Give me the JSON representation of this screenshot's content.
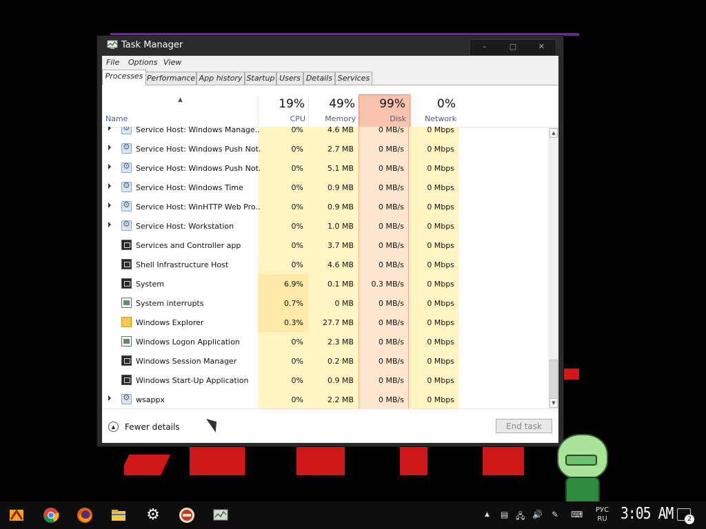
{
  "window": {
    "title": "Task Manager",
    "controls": [
      "–",
      "□",
      "✕"
    ]
  },
  "menu": [
    "File",
    "Options",
    "View"
  ],
  "tabs": [
    "Processes",
    "Performance",
    "App history",
    "Startup",
    "Users",
    "Details",
    "Services"
  ],
  "active_tab": "Processes",
  "columns": {
    "name": "Name",
    "cpu": {
      "pct": "19%",
      "label": "CPU"
    },
    "memory": {
      "pct": "49%",
      "label": "Memory"
    },
    "disk": {
      "pct": "99%",
      "label": "Disk"
    },
    "network": {
      "pct": "0%",
      "label": "Network"
    }
  },
  "rows": [
    {
      "name": "Service Host: Windows Manage...",
      "icon": "gear-icon",
      "expandable": true,
      "cpu": "0%",
      "mem": "4.6 MB",
      "disk": "0 MB/s",
      "net": "0 Mbps",
      "partial": true
    },
    {
      "name": "Service Host: Windows Push Not...",
      "icon": "gear-icon",
      "expandable": true,
      "cpu": "0%",
      "mem": "2.7 MB",
      "disk": "0 MB/s",
      "net": "0 Mbps"
    },
    {
      "name": "Service Host: Windows Push Not...",
      "icon": "gear-icon",
      "expandable": true,
      "cpu": "0%",
      "mem": "5.1 MB",
      "disk": "0 MB/s",
      "net": "0 Mbps"
    },
    {
      "name": "Service Host: Windows Time",
      "icon": "gear-icon",
      "expandable": true,
      "cpu": "0%",
      "mem": "0.9 MB",
      "disk": "0 MB/s",
      "net": "0 Mbps"
    },
    {
      "name": "Service Host: WinHTTP Web Pro...",
      "icon": "gear-icon",
      "expandable": true,
      "cpu": "0%",
      "mem": "0.9 MB",
      "disk": "0 MB/s",
      "net": "0 Mbps"
    },
    {
      "name": "Service Host: Workstation",
      "icon": "gear-icon",
      "expandable": true,
      "cpu": "0%",
      "mem": "1.0 MB",
      "disk": "0 MB/s",
      "net": "0 Mbps"
    },
    {
      "name": "Services and Controller app",
      "icon": "app-icon",
      "expandable": false,
      "cpu": "0%",
      "mem": "3.7 MB",
      "disk": "0 MB/s",
      "net": "0 Mbps"
    },
    {
      "name": "Shell Infrastructure Host",
      "icon": "app-icon",
      "expandable": false,
      "cpu": "0%",
      "mem": "4.6 MB",
      "disk": "0 MB/s",
      "net": "0 Mbps"
    },
    {
      "name": "System",
      "icon": "app-icon",
      "expandable": false,
      "cpu": "6.9%",
      "mem": "0.1 MB",
      "disk": "0.3 MB/s",
      "net": "0 Mbps"
    },
    {
      "name": "System interrupts",
      "icon": "window-icon",
      "expandable": false,
      "cpu": "0.7%",
      "mem": "0 MB",
      "disk": "0 MB/s",
      "net": "0 Mbps"
    },
    {
      "name": "Windows Explorer",
      "icon": "folder-icon",
      "expandable": false,
      "cpu": "0.3%",
      "mem": "27.7 MB",
      "disk": "0 MB/s",
      "net": "0 Mbps"
    },
    {
      "name": "Windows Logon Application",
      "icon": "window-icon",
      "expandable": false,
      "cpu": "0%",
      "mem": "2.3 MB",
      "disk": "0 MB/s",
      "net": "0 Mbps"
    },
    {
      "name": "Windows Session Manager",
      "icon": "app-icon",
      "expandable": false,
      "cpu": "0%",
      "mem": "0.2 MB",
      "disk": "0 MB/s",
      "net": "0 Mbps"
    },
    {
      "name": "Windows Start-Up Application",
      "icon": "app-icon",
      "expandable": false,
      "cpu": "0%",
      "mem": "0.9 MB",
      "disk": "0 MB/s",
      "net": "0 Mbps"
    },
    {
      "name": "wsappx",
      "icon": "gear-icon",
      "expandable": true,
      "cpu": "0%",
      "mem": "2.2 MB",
      "disk": "0 MB/s",
      "net": "0 Mbps"
    }
  ],
  "footer": {
    "fewer_details": "Fewer details",
    "end_task": "End task"
  },
  "taskbar": {
    "apps": [
      "start-icon",
      "chrome-icon",
      "firefox-icon",
      "file-explorer-icon",
      "settings-gear-icon",
      "game-icon",
      "task-manager-icon"
    ],
    "lang_top": "РУС",
    "lang_bottom": "RU",
    "clock": "3:05 AM",
    "notification_count": "2"
  },
  "colors": {
    "cpu_bg": "#fff4c4",
    "cpu_hot": "#ffe9a8",
    "disk_bg": "#fde3c8",
    "disk_header": "#f9c2ad",
    "accent_red": "#d01818"
  }
}
